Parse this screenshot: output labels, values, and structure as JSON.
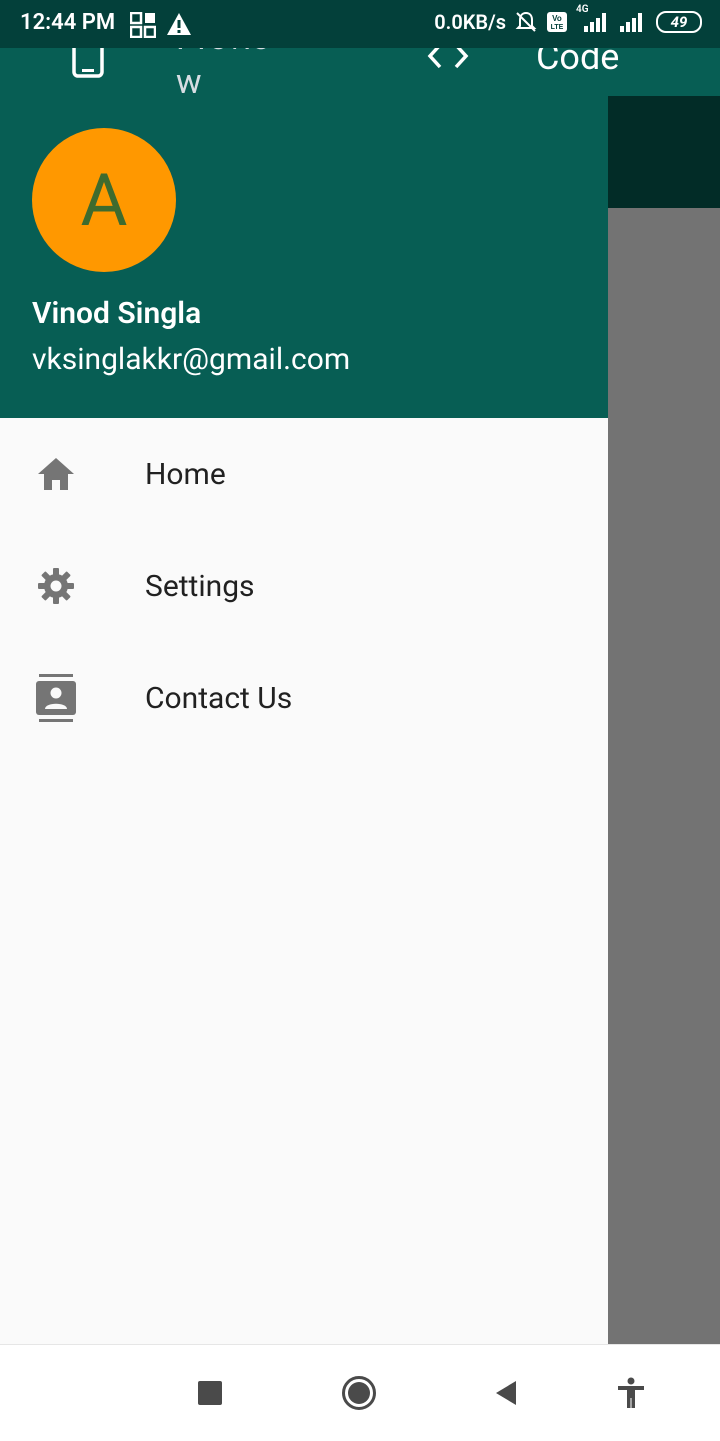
{
  "status_bar": {
    "time": "12:44 PM",
    "speed": "0.0KB/s",
    "network": "4G",
    "battery": "49"
  },
  "tabs": {
    "preview_label": "Preview",
    "code_label": "Code"
  },
  "drawer": {
    "avatar_letter": "A",
    "account_name": "Vinod Singla",
    "account_email": "vksinglakkr@gmail.com",
    "items": [
      {
        "label": "Home",
        "icon": "home-icon"
      },
      {
        "label": "Settings",
        "icon": "gear-icon"
      },
      {
        "label": "Contact Us",
        "icon": "contacts-icon"
      }
    ]
  },
  "colors": {
    "primary": "#075e54",
    "status_bar": "#03403a",
    "avatar_bg": "#ff9800",
    "avatar_text": "#3e6b2e",
    "scrim": "#737373"
  }
}
